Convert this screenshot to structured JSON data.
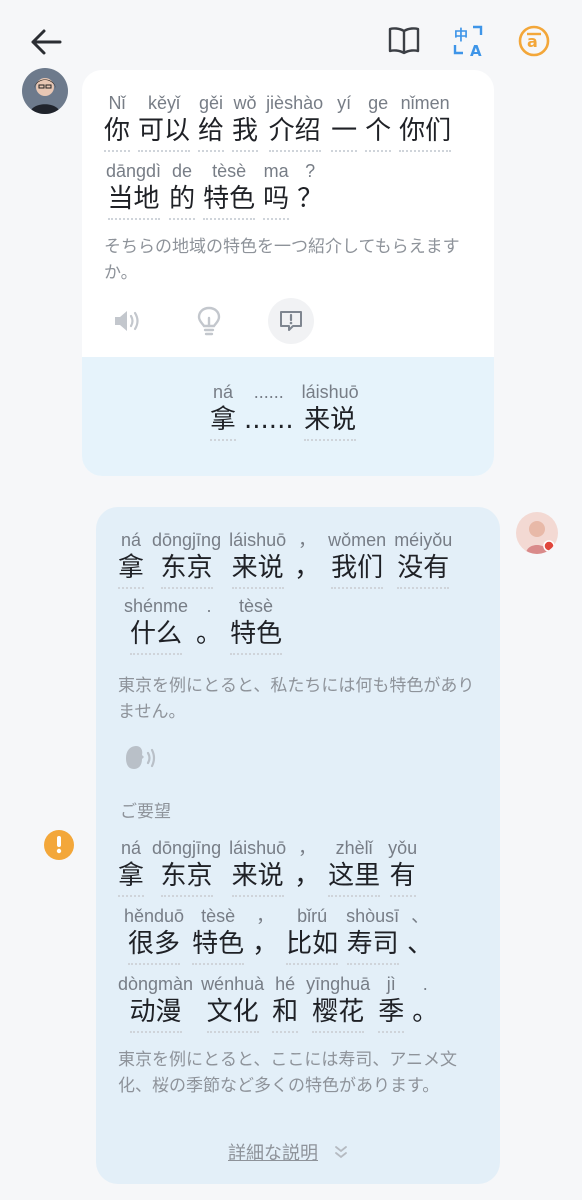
{
  "icons": {
    "back": "back-arrow-icon",
    "book": "book-icon",
    "translate": "translate-icon",
    "mode": "a-circle-icon",
    "speaker": "speaker-icon",
    "hint": "lightbulb-icon",
    "feedback": "feedback-icon",
    "voice": "voice-icon",
    "warning": "warning-icon",
    "expand": "chevron-down-double-icon"
  },
  "colors": {
    "accent": "#f3a73a",
    "card_tip": "#e6f3fb",
    "user_card": "#e3eff8",
    "translate_blue": "#3e95e8"
  },
  "tutor": {
    "line1": [
      {
        "py": "Nǐ",
        "hz": "你"
      },
      {
        "py": "kěyǐ",
        "hz": "可以"
      },
      {
        "py": "gěi",
        "hz": "给"
      },
      {
        "py": "wǒ",
        "hz": "我"
      },
      {
        "py": "jièshào",
        "hz": "介绍"
      },
      {
        "py": "yí",
        "hz": "一"
      },
      {
        "py": "ge",
        "hz": "个"
      },
      {
        "py": "nǐmen",
        "hz": "你们"
      }
    ],
    "line2": [
      {
        "py": "dāngdì",
        "hz": "当地"
      },
      {
        "py": "de",
        "hz": "的"
      },
      {
        "py": "tèsè",
        "hz": "特色"
      },
      {
        "py": "ma",
        "hz": "吗"
      },
      {
        "py": "?",
        "hz": "？"
      }
    ],
    "translation": "そちらの地域の特色を一つ紹介してもらえますか。",
    "tip": [
      {
        "py": "ná",
        "hz": "拿"
      },
      {
        "py": "......",
        "hz": "......"
      },
      {
        "py": "láishuō",
        "hz": "来说"
      }
    ]
  },
  "user": {
    "line1": [
      {
        "py": "ná",
        "hz": "拿"
      },
      {
        "py": "dōngjīng",
        "hz": "东京"
      },
      {
        "py": "láishuō",
        "hz": "来说"
      },
      {
        "py": "，",
        "hz": "，"
      },
      {
        "py": "wǒmen",
        "hz": "我们"
      },
      {
        "py": "méiyǒu",
        "hz": "没有"
      }
    ],
    "line2": [
      {
        "py": "shénme",
        "hz": "什么"
      },
      {
        "py": ".",
        "hz": "。"
      },
      {
        "py": "tèsè",
        "hz": "特色"
      }
    ],
    "translation": "東京を例にとると、私たちには何も特色がありません。",
    "suggestion_label": "ご要望",
    "s_line1": [
      {
        "py": "ná",
        "hz": "拿"
      },
      {
        "py": "dōngjīng",
        "hz": "东京"
      },
      {
        "py": "láishuō",
        "hz": "来说"
      },
      {
        "py": "，",
        "hz": "，"
      },
      {
        "py": "zhèlǐ",
        "hz": "这里"
      },
      {
        "py": "yǒu",
        "hz": "有"
      }
    ],
    "s_line2": [
      {
        "py": "hěnduō",
        "hz": "很多"
      },
      {
        "py": "tèsè",
        "hz": "特色"
      },
      {
        "py": "，",
        "hz": "，"
      },
      {
        "py": "bǐrú",
        "hz": "比如"
      },
      {
        "py": "shòusī",
        "hz": "寿司"
      },
      {
        "py": "、",
        "hz": "、"
      }
    ],
    "s_line3": [
      {
        "py": "dòngmàn",
        "hz": "动漫"
      },
      {
        "py": "wénhuà",
        "hz": "文化"
      },
      {
        "py": "hé",
        "hz": "和"
      },
      {
        "py": "yīnghuā",
        "hz": "樱花"
      },
      {
        "py": "jì",
        "hz": "季"
      },
      {
        "py": ".",
        "hz": "。"
      }
    ],
    "s_translation": "東京を例にとると、ここには寿司、アニメ文化、桜の季節など多くの特色があります。",
    "detail_link": "詳細な説明"
  }
}
